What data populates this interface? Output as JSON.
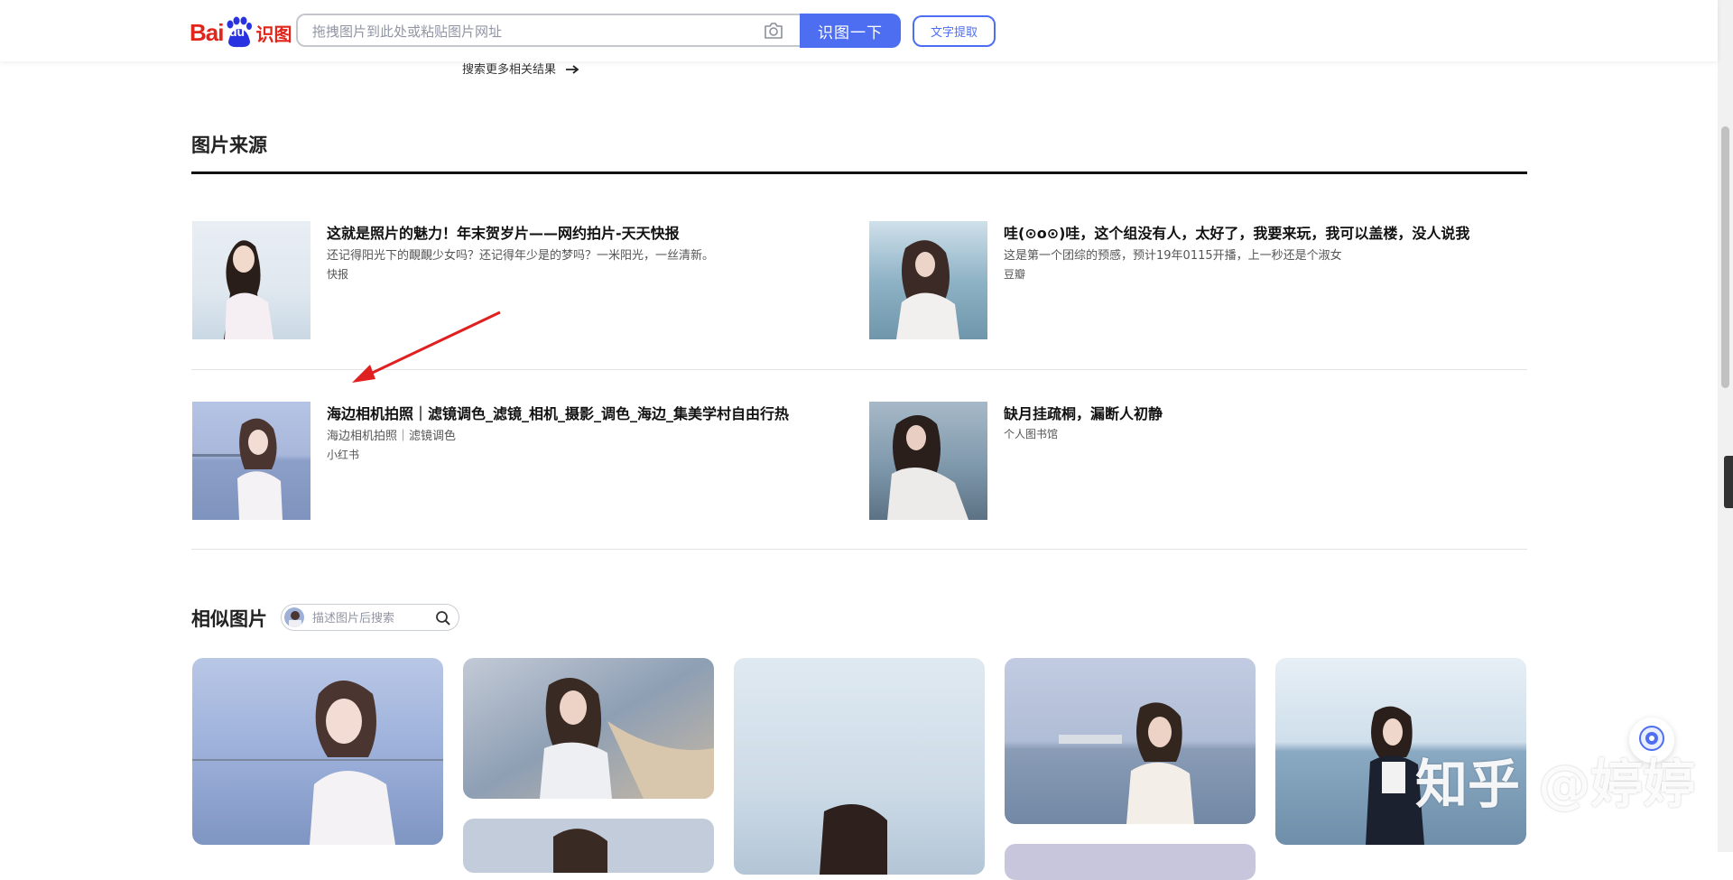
{
  "header": {
    "logo_text": "Bai du 识图",
    "logo_bai": "Bai",
    "logo_du": "du",
    "logo_shitu": "识图",
    "search_placeholder": "拖拽图片到此处或粘贴图片网址",
    "search_button": "识图一下",
    "text_extract_button": "文字提取"
  },
  "more_results": "搜索更多相关结果",
  "sources": {
    "title": "图片来源",
    "items": [
      {
        "title": "这就是照片的魅力！年末贺岁片——网约拍片-天天快报",
        "desc": "还记得阳光下的靦靦少女吗？还记得年少是的梦吗？一米阳光，一丝清新。",
        "site": "快报"
      },
      {
        "title": "哇(⊙o⊙)哇，这个组没有人，太好了，我要来玩，我可以盖楼，没人说我",
        "desc": "这是第一个团综的预感，预计19年0115开播，上一秒还是个淑女",
        "site": "豆瓣"
      },
      {
        "title": "海边相机拍照｜滤镜调色_滤镜_相机_摄影_调色_海边_集美学村自由行热",
        "desc": "海边相机拍照｜滤镜调色",
        "site": "小红书"
      },
      {
        "title": "缺月挂疏桐，漏断人初静",
        "desc": "",
        "site": "个人图书馆"
      }
    ]
  },
  "similar": {
    "title": "相似图片",
    "search_placeholder": "描述图片后搜索"
  },
  "overlay": {
    "watermark": "知乎 @婷婷"
  },
  "colors": {
    "brand_red": "#e1251b",
    "accent_blue": "#4e6ef2"
  }
}
